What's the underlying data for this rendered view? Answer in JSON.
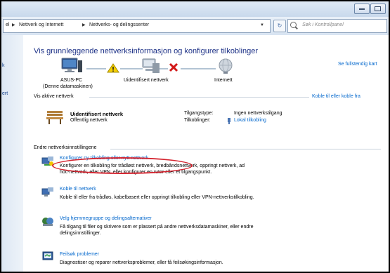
{
  "address": {
    "crumb_prev": "el",
    "crumb_1": "Nettverk og Internett",
    "crumb_2": "Nettverks- og delingssenter"
  },
  "search": {
    "placeholder": "Søk i Kontrollpanel"
  },
  "leftnav": {
    "item_1": "k",
    "item_2": "ert"
  },
  "main": {
    "heading": "Vis grunnleggende nettverksinformasjon og konfigurer tilkoblinger",
    "full_map_link": "Se fullstendig kart",
    "map": {
      "pc_name": "ASUS-PC",
      "pc_desc": "(Denne datamaskinen)",
      "network": "Uidentifisert nettverk",
      "internet": "Internett"
    },
    "active_networks": {
      "title": "Vis aktive nettverk",
      "connect_link": "Koble til eller koble fra",
      "name": "Uidentifisert nettverk",
      "type": "Offentlig nettverk",
      "access_label": "Tilgangstype:",
      "access_value": "Ingen nettverkstilgang",
      "connections_label": "Tilkoblinger:",
      "connections_value": "Lokal tilkobling"
    },
    "settings": {
      "title": "Endre nettverksinnstillingene",
      "items": [
        {
          "link": "Konfigurer ny tilkobling eller nytt nettverk",
          "line1": "Konfigurer en tilkobling for trådløst nettverk, bredbåndsnettverk, oppringt nettverk, ad",
          "line2": "hoc-nettverk, eller VPN, eller konfigurer en ruter eller et tilgangspunkt."
        },
        {
          "link": "Koble til nettverk",
          "line1": "Koble til eller fra trådløs, kabelbasert eller oppringt tilkobling eller VPN-nettverkstilkobling."
        },
        {
          "link": "Velg hjemmegruppe og delingsalternativer",
          "line1": "Få tilgang til filer og skrivere som er plassert på andre nettverksdatamaskiner, eller endre",
          "line2": "delingsinnstillinger."
        },
        {
          "link": "Feilsøk problemer",
          "line1": "Diagnostiser og reparer nettverksproblemer, eller få feilsøkingsinformasjon."
        }
      ]
    }
  }
}
